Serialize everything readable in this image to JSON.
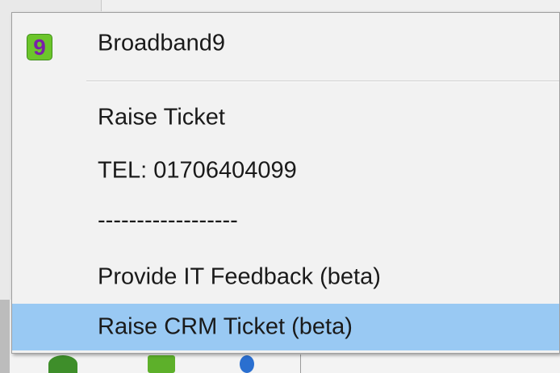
{
  "menu": {
    "header": {
      "app_name": "Broadband9",
      "icon": "broadband9-logo-icon",
      "icon_glyph": "9",
      "icon_color": "#6cc52b",
      "icon_glyph_color": "#7a1fa8"
    },
    "items": [
      {
        "label": "Raise Ticket",
        "highlighted": false
      },
      {
        "label": "TEL: 01706404099",
        "highlighted": false
      },
      {
        "label": "------------------",
        "highlighted": false
      },
      {
        "label": "Provide IT Feedback (beta)",
        "highlighted": false
      },
      {
        "label": "Raise CRM Ticket (beta)",
        "highlighted": true
      }
    ],
    "highlight_color": "#99c9f3"
  }
}
